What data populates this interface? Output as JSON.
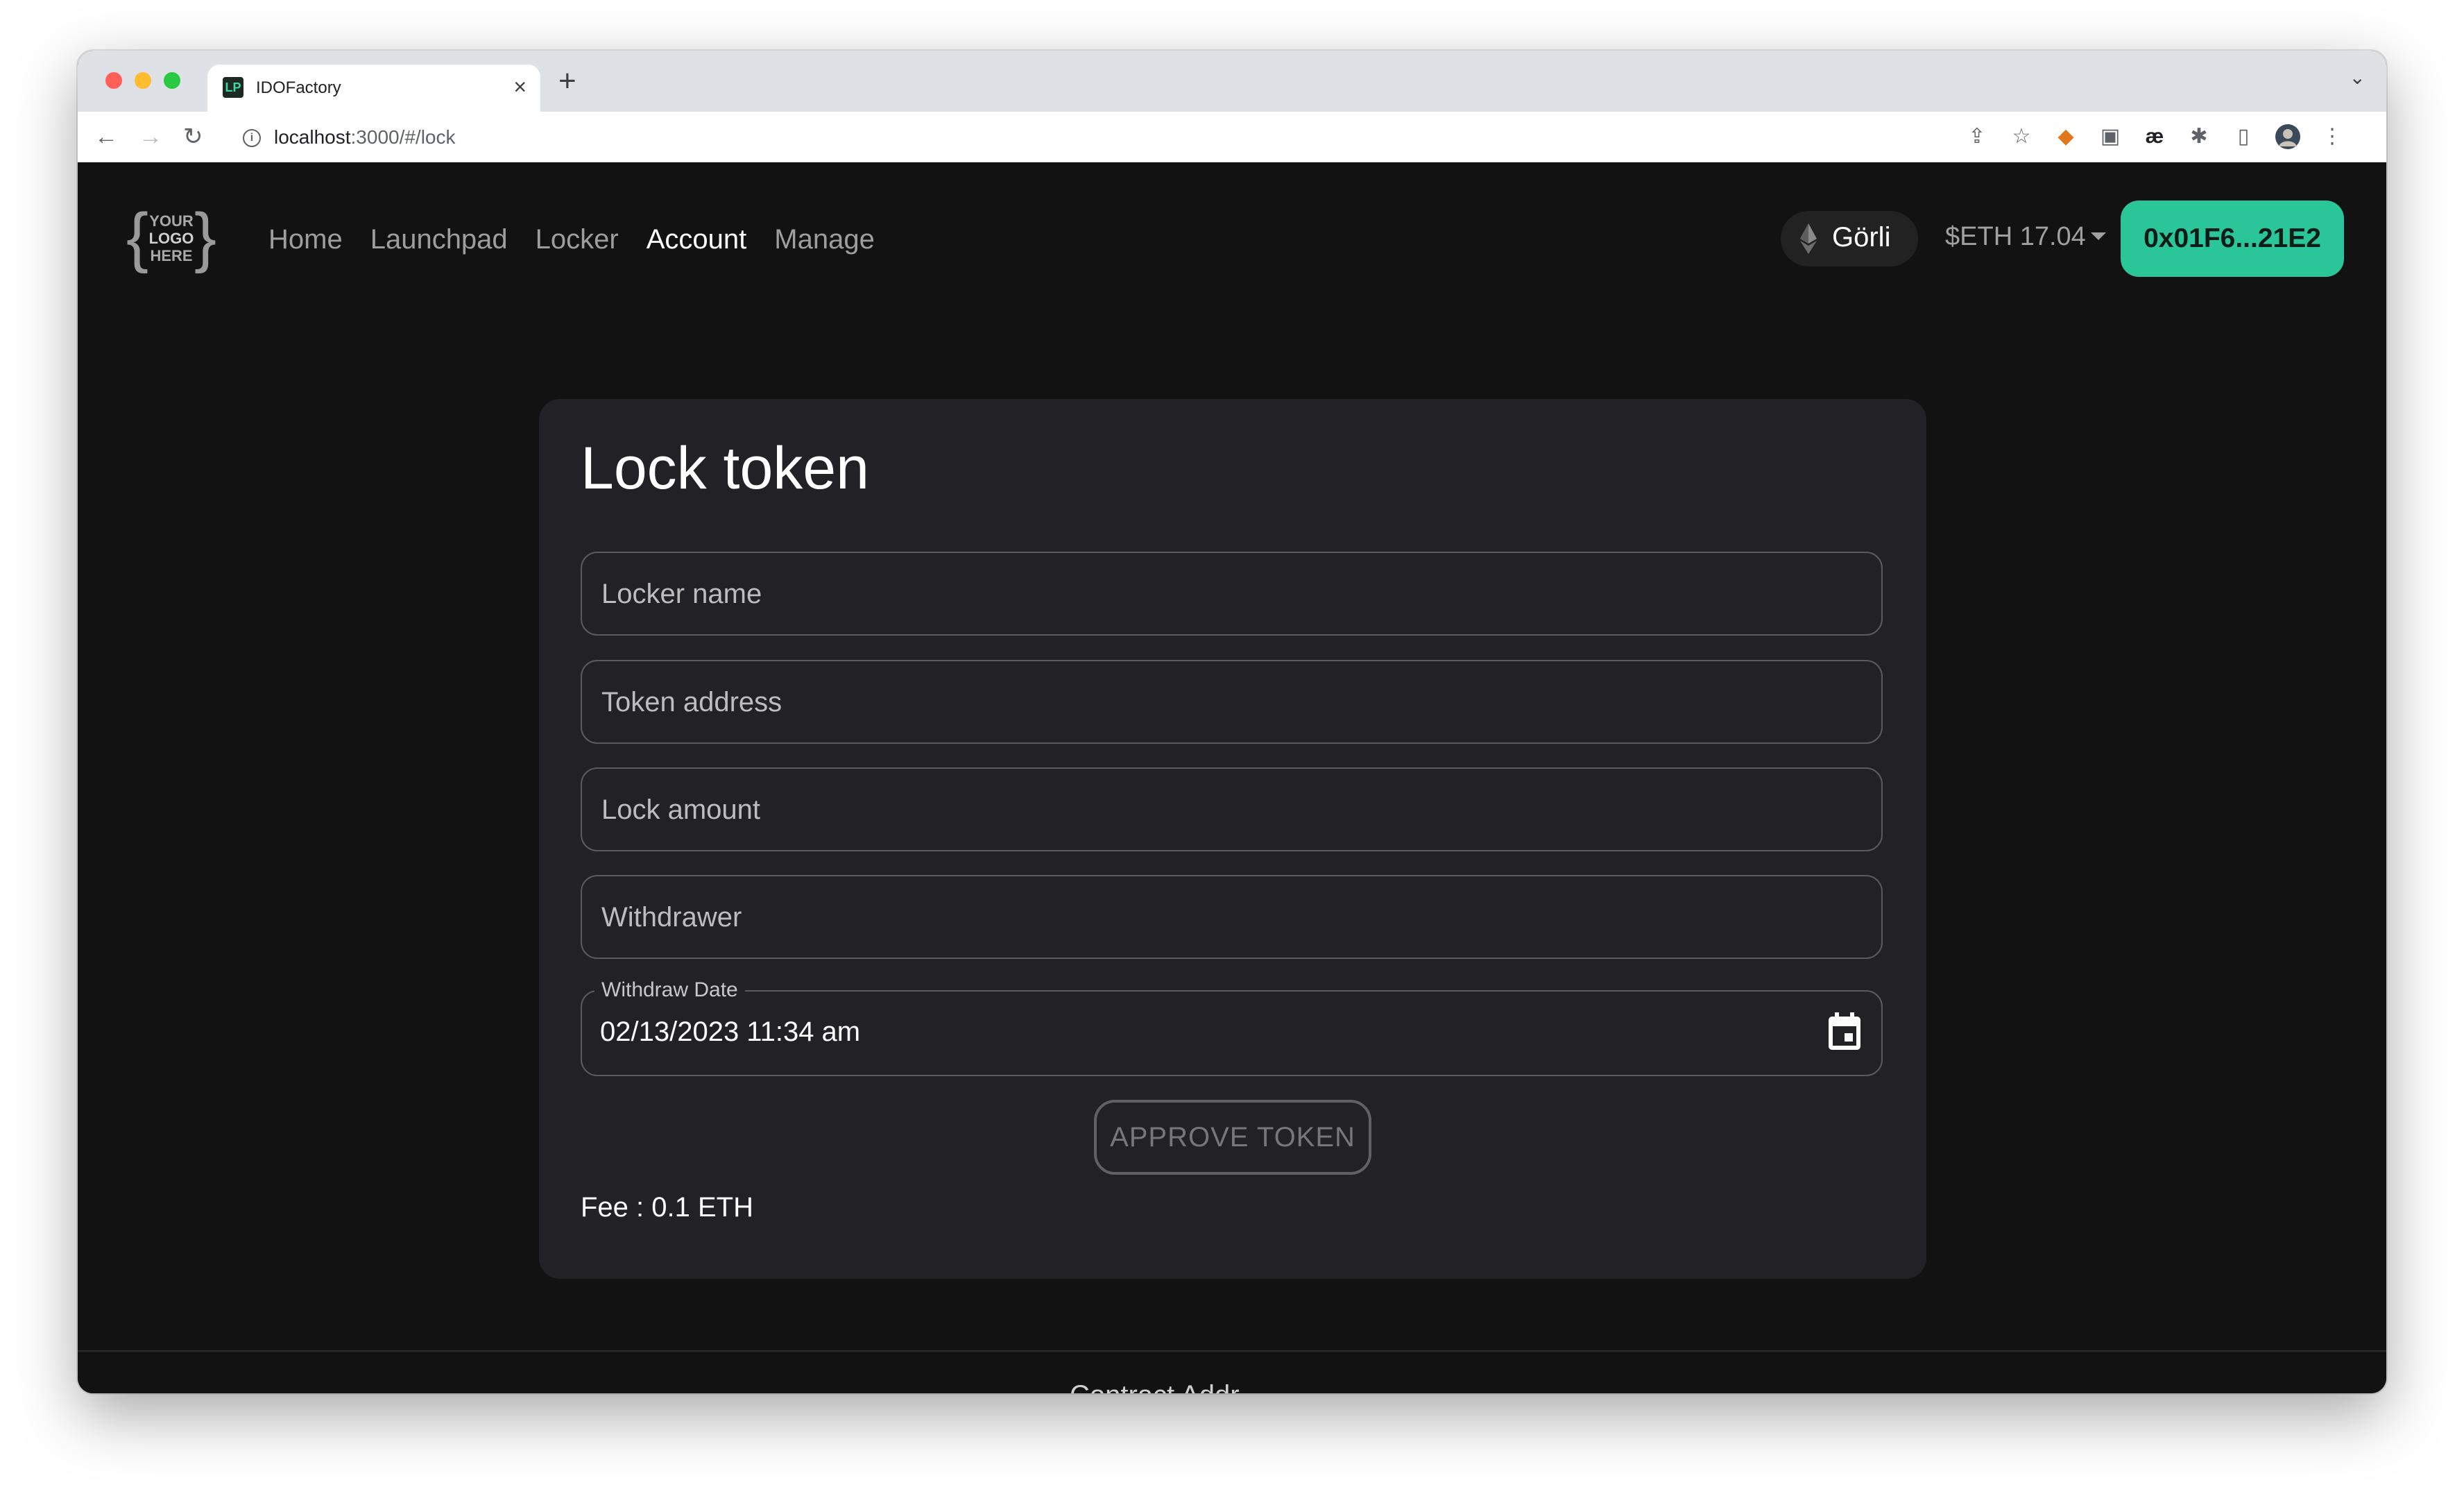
{
  "browser": {
    "tab_title": "IDOFactory",
    "favicon": "LP",
    "tab_close": "×",
    "new_tab": "+",
    "tab_menu": "⌄",
    "url_host": "localhost",
    "url_path": ":3000/#/lock",
    "icons": [
      "back-arrow-icon",
      "forward-arrow-icon",
      "reload-icon",
      "info-icon",
      "share-icon",
      "star-icon",
      "metamask-icon",
      "extension-icon",
      "ae-icon",
      "puzzle-icon",
      "sidebar-icon",
      "profile-avatar-icon",
      "more-menu-icon"
    ]
  },
  "header": {
    "logo_text": [
      "YOUR",
      "LOGO",
      "HERE"
    ],
    "nav": [
      "Home",
      "Launchpad",
      "Locker",
      "Account",
      "Manage"
    ],
    "active_nav": "Account",
    "network": "Görli",
    "balance": "$ETH 17.04",
    "wallet": "0x01F6...21E2"
  },
  "form": {
    "title": "Lock token",
    "fields": {
      "locker_name": "Locker name",
      "token_address": "Token address",
      "lock_amount": "Lock amount",
      "withdrawer": "Withdrawer"
    },
    "date_label": "Withdraw Date",
    "date_value": "02/13/2023 11:34 am",
    "approve": "APPROVE TOKEN",
    "fee": "Fee : 0.1 ETH"
  },
  "footer": {
    "partial_text": "Contract Addr"
  },
  "colors": {
    "accent": "#2bc59a",
    "background": "#121212",
    "card": "#222126"
  }
}
